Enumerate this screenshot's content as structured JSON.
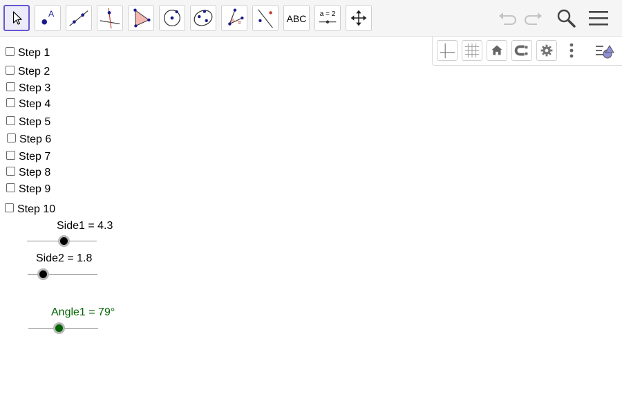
{
  "toolbar": {
    "tools": [
      {
        "name": "move-tool",
        "icon": "cursor-arrow-icon",
        "selected": true
      },
      {
        "name": "point-tool",
        "icon": "point-icon",
        "label": "A"
      },
      {
        "name": "line-tool",
        "icon": "line-icon"
      },
      {
        "name": "perpendicular-line-tool",
        "icon": "perpendicular-line-icon"
      },
      {
        "name": "polygon-tool",
        "icon": "polygon-icon"
      },
      {
        "name": "circle-center-point-tool",
        "icon": "circle-icon"
      },
      {
        "name": "ellipse-tool",
        "icon": "ellipse-icon"
      },
      {
        "name": "angle-tool",
        "icon": "angle-icon",
        "label": "α"
      },
      {
        "name": "reflect-tool",
        "icon": "reflect-icon"
      },
      {
        "name": "text-tool",
        "icon": "text-icon",
        "label": "ABC"
      },
      {
        "name": "slider-tool",
        "icon": "slider-icon",
        "label": "a = 2"
      },
      {
        "name": "move-graphics-tool",
        "icon": "move-arrows-icon"
      }
    ],
    "right": [
      "undo-icon",
      "redo-icon",
      "search-icon",
      "menu-icon"
    ]
  },
  "graphics_bar": [
    "axes-icon",
    "grid-icon",
    "home-icon",
    "point-capture-icon",
    "gear-icon",
    "more-icon",
    "style-bar-icon"
  ],
  "steps": [
    {
      "label": "Step 1",
      "checked": false
    },
    {
      "label": "Step 2",
      "checked": false
    },
    {
      "label": "Step 3",
      "checked": false
    },
    {
      "label": "Step 4",
      "checked": false
    },
    {
      "label": "Step 5",
      "checked": false
    },
    {
      "label": "Step 6",
      "checked": false
    },
    {
      "label": "Step 7",
      "checked": false
    },
    {
      "label": "Step 8",
      "checked": false
    },
    {
      "label": "Step 9",
      "checked": false
    },
    {
      "label": "Step 10",
      "checked": false
    }
  ],
  "sliders": [
    {
      "label": "Side1 = 4.3",
      "value": 4.3,
      "fraction": 0.53,
      "color": "#000000"
    },
    {
      "label": "Side2 = 1.8",
      "value": 1.8,
      "fraction": 0.22,
      "color": "#000000"
    },
    {
      "label": "Angle1 = 79°",
      "value": 79,
      "fraction": 0.44,
      "color": "#006400"
    }
  ],
  "colors": {
    "selected_border": "#6557d2",
    "point": "#1a1a8c",
    "polygon_fill": "#f4b8b0",
    "angle_label": "#006400"
  }
}
